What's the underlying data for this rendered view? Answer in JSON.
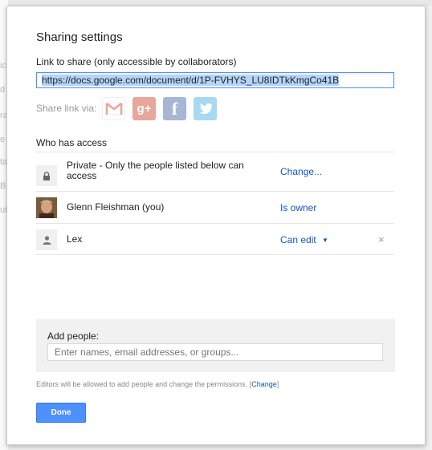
{
  "background": {
    "edge_fragments": [
      "ic",
      "d",
      "ra",
      "e",
      "ta",
      "B",
      "ut"
    ]
  },
  "dialog": {
    "title": "Sharing settings",
    "link": {
      "label": "Link to share (only accessible by collaborators)",
      "url": "https://docs.google.com/document/d/1P-FVHYS_LU8IDTkKmgCo41B"
    },
    "share_via": {
      "label": "Share link via:",
      "services": [
        {
          "name": "Gmail",
          "icon": "gmail-icon",
          "color": "#d14836"
        },
        {
          "name": "Google+",
          "icon": "google-plus-icon",
          "color": "#e8a79b"
        },
        {
          "name": "Facebook",
          "icon": "facebook-icon",
          "color": "#a8b6d3"
        },
        {
          "name": "Twitter",
          "icon": "twitter-icon",
          "color": "#a7d9f2"
        }
      ]
    },
    "access": {
      "heading": "Who has access",
      "entries": [
        {
          "icon": "lock-icon",
          "name": "Private - Only the people listed below can access",
          "action": "Change..."
        },
        {
          "icon": "avatar",
          "name": "Glenn Fleishman (you)",
          "action": "Is owner"
        },
        {
          "icon": "person-icon",
          "name": "Lex",
          "action": "Can edit",
          "dropdown": "▼",
          "remove": "×"
        }
      ]
    },
    "add_people": {
      "label": "Add people:",
      "placeholder": "Enter names, email addresses, or groups..."
    },
    "editors_note": {
      "text": "Editors will be allowed to add people and change the permissions.",
      "bracket_open": "[",
      "link": "Change",
      "bracket_close": "]"
    },
    "done_button": "Done",
    "accent_color": "#4d90fe",
    "link_color": "#1155cc"
  }
}
